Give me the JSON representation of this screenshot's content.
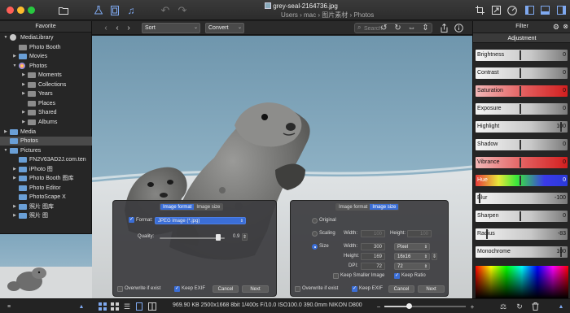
{
  "window": {
    "title": "grey-seal-2164736.jpg",
    "path": "Users  ›  mac  ›  图片素材  ›  Photos"
  },
  "colors": {
    "accent": "#3b6ed6",
    "close": "#ff5f57",
    "minimize": "#febc2e",
    "zoom": "#28c840"
  },
  "sidebar": {
    "header": "Favorite",
    "items": [
      {
        "label": "MediaLibrary",
        "level": 0,
        "expand": "open",
        "icon": "media-library-icon"
      },
      {
        "label": "Photo Booth",
        "level": 1,
        "expand": "none",
        "icon": "photo-booth-icon"
      },
      {
        "label": "Movies",
        "level": 1,
        "expand": "closed",
        "icon": "folder-icon"
      },
      {
        "label": "Photos",
        "level": 1,
        "expand": "open",
        "icon": "photos-app-icon"
      },
      {
        "label": "Moments",
        "level": 2,
        "expand": "closed",
        "icon": "moments-icon"
      },
      {
        "label": "Collections",
        "level": 2,
        "expand": "closed",
        "icon": "collections-icon"
      },
      {
        "label": "Years",
        "level": 2,
        "expand": "closed",
        "icon": "years-icon"
      },
      {
        "label": "Places",
        "level": 2,
        "expand": "none",
        "icon": "places-icon"
      },
      {
        "label": "Shared",
        "level": 2,
        "expand": "closed",
        "icon": "shared-icon"
      },
      {
        "label": "Albums",
        "level": 2,
        "expand": "closed",
        "icon": "albums-icon"
      },
      {
        "label": "Media",
        "level": 0,
        "expand": "closed",
        "icon": "folder-icon"
      },
      {
        "label": "Photos",
        "level": 0,
        "expand": "none",
        "icon": "folder-icon",
        "selected": true
      },
      {
        "label": "Pictures",
        "level": 0,
        "expand": "open",
        "icon": "folder-icon"
      },
      {
        "label": "FN2V63AD2J.com.ten",
        "level": 1,
        "expand": "none",
        "icon": "folder-icon"
      },
      {
        "label": "iPhoto 图",
        "level": 1,
        "expand": "closed",
        "icon": "folder-icon"
      },
      {
        "label": "Photo Booth 图库",
        "level": 1,
        "expand": "closed",
        "icon": "folder-icon"
      },
      {
        "label": "Photo Editor",
        "level": 1,
        "expand": "none",
        "icon": "folder-icon"
      },
      {
        "label": "PhotoScape X",
        "level": 1,
        "expand": "none",
        "icon": "folder-icon"
      },
      {
        "label": "照片 图库",
        "level": 1,
        "expand": "closed",
        "icon": "folder-icon"
      },
      {
        "label": "照片 图",
        "level": 1,
        "expand": "closed",
        "icon": "folder-icon"
      }
    ]
  },
  "viewer_toolbar": {
    "sort_label": "Sort",
    "convert_label": "Convert",
    "search_placeholder": "Search"
  },
  "format_panel": {
    "tab_format": "Image format",
    "tab_size": "Image size",
    "active_tab": "format",
    "format_label": "Format:",
    "format_value": "JPEG image (*.jpg)",
    "quality_label": "Quality:",
    "quality_value": "0.9",
    "quality_fraction": 0.9,
    "overwrite_label": "Overwrite if exist",
    "overwrite_checked": false,
    "keep_exif_label": "Keep EXIF",
    "keep_exif_checked": true,
    "cancel_label": "Cancel",
    "next_label": "Next"
  },
  "size_panel": {
    "tab_format": "Image format",
    "tab_size": "Image size",
    "active_tab": "size",
    "original_label": "Original",
    "scaling_label": "Scaling",
    "size_label": "Size",
    "selected_mode": "size",
    "scaling_width_label": "Width:",
    "scaling_width": "100",
    "scaling_height_label": "Height:",
    "scaling_height": "100",
    "width_label": "Width:",
    "width_value": "300",
    "width_unit": "Pixel",
    "height_label": "Height:",
    "height_value": "169",
    "height_ratio": "16x16",
    "dpi_label": "DPI:",
    "dpi_value": "72",
    "dpi_select": "72",
    "keep_smaller_label": "Keep Smaller Image",
    "keep_smaller_checked": false,
    "keep_ratio_label": "Keep Ratio",
    "keep_ratio_checked": true,
    "overwrite_label": "Overwrite if exist",
    "overwrite_checked": false,
    "keep_exif_label": "Keep EXIF",
    "keep_exif_checked": true,
    "cancel_label": "Cancel",
    "next_label": "Next"
  },
  "right_panel": {
    "header": "Filter",
    "adjustment_label": "Adjustment",
    "adjustments": [
      {
        "label": "Brightness",
        "value": "0",
        "level": 0.5,
        "kind": "gray"
      },
      {
        "label": "Contrast",
        "value": "0",
        "level": 0.5,
        "kind": "gray"
      },
      {
        "label": "Saturation",
        "value": "0",
        "level": 0.5,
        "kind": "red"
      },
      {
        "label": "Exposure",
        "value": "0",
        "level": 0.5,
        "kind": "gray"
      },
      {
        "label": "Highlight",
        "value": "100",
        "level": 1.0,
        "kind": "gray"
      },
      {
        "label": "Shadow",
        "value": "0",
        "level": 0.5,
        "kind": "gray"
      },
      {
        "label": "Vibrance",
        "value": "0",
        "level": 0.5,
        "kind": "red"
      },
      {
        "label": "Hue",
        "value": "0",
        "level": 0.5,
        "kind": "hue"
      },
      {
        "label": "Blur",
        "value": "-100",
        "level": 0.0,
        "kind": "gray"
      },
      {
        "label": "Sharpen",
        "value": "0",
        "level": 0.5,
        "kind": "gray"
      },
      {
        "label": "Radius",
        "value": "-83",
        "level": 0.09,
        "kind": "gray"
      },
      {
        "label": "Monochrome",
        "value": "100",
        "level": 1.0,
        "kind": "gray"
      }
    ]
  },
  "status": {
    "text": "969.90 KB   2500x1668   8bit   1/400s   F/10.0   ISO100.0   390.0mm   NIKON D800",
    "zoom_fraction": 0.3
  }
}
